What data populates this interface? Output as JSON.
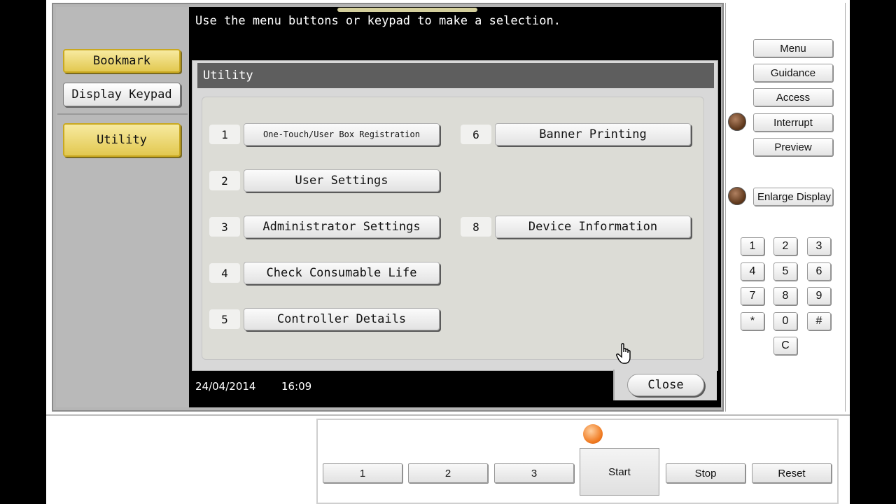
{
  "screen": {
    "prompt": "Use the menu buttons or keypad to make a selection.",
    "date": "24/04/2014",
    "time": "16:09"
  },
  "left_panel": {
    "bookmark": "Bookmark",
    "display_keypad": "Display Keypad",
    "utility": "Utility"
  },
  "dialog": {
    "title": "Utility",
    "items": [
      {
        "num": "1",
        "label": "One-Touch/User Box Registration"
      },
      {
        "num": "2",
        "label": "User Settings"
      },
      {
        "num": "3",
        "label": "Administrator Settings"
      },
      {
        "num": "4",
        "label": "Check Consumable Life"
      },
      {
        "num": "5",
        "label": "Controller Details"
      },
      {
        "num": "6",
        "label": "Banner Printing"
      },
      {
        "num": "8",
        "label": "Device Information"
      }
    ],
    "close": "Close"
  },
  "right_panel": {
    "menu": "Menu",
    "guidance": "Guidance",
    "access": "Access",
    "interrupt": "Interrupt",
    "preview": "Preview",
    "enlarge_display": "Enlarge Display",
    "keypad": [
      "1",
      "2",
      "3",
      "4",
      "5",
      "6",
      "7",
      "8",
      "9",
      "*",
      "0",
      "#",
      "C"
    ]
  },
  "bottom_panel": {
    "b1": "1",
    "b2": "2",
    "b3": "3",
    "start": "Start",
    "stop": "Stop",
    "reset": "Reset"
  },
  "colors": {
    "accent_yellow": "#e2c850",
    "start_led": "#f07a20"
  }
}
